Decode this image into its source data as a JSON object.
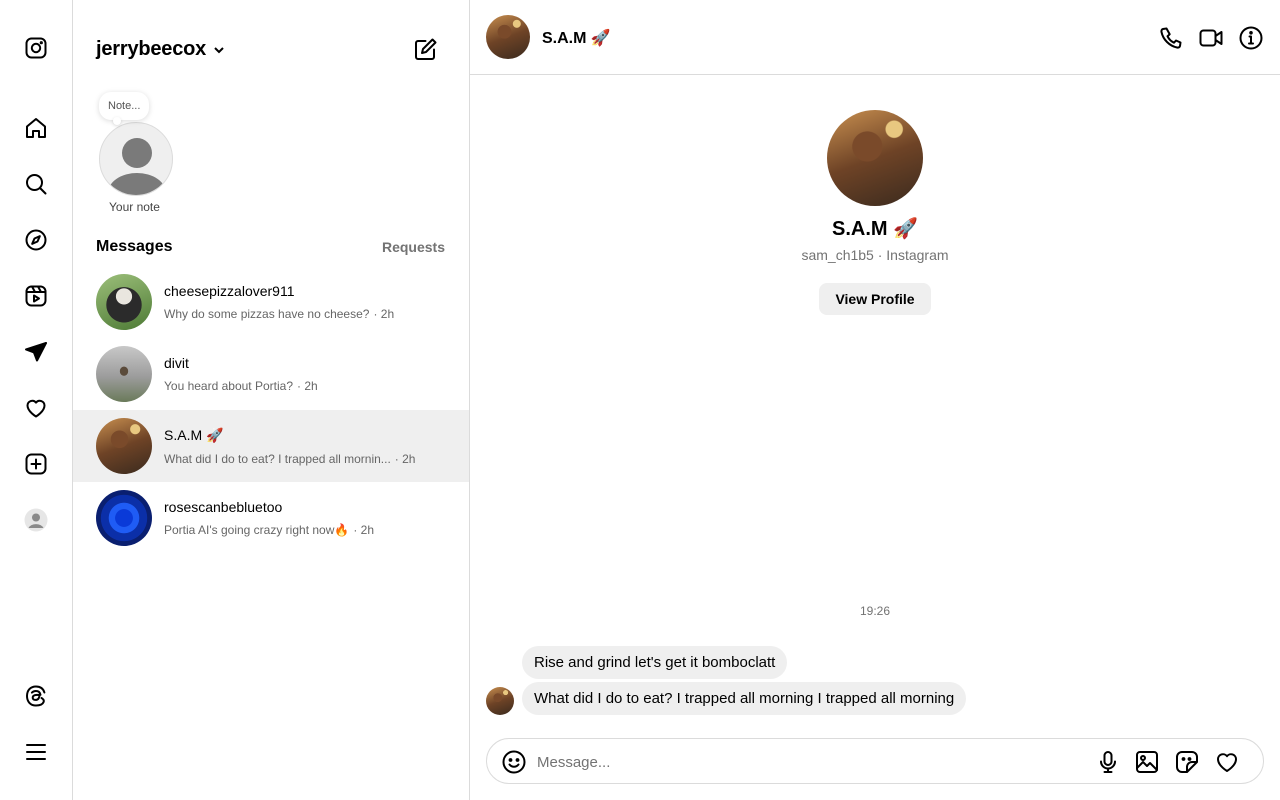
{
  "nav": {
    "items": [
      {
        "name": "instagram-logo-icon"
      },
      {
        "name": "home-icon"
      },
      {
        "name": "search-icon"
      },
      {
        "name": "explore-icon"
      },
      {
        "name": "reels-icon"
      },
      {
        "name": "messages-icon"
      },
      {
        "name": "notifications-heart-icon"
      },
      {
        "name": "create-plus-icon"
      },
      {
        "name": "profile-avatar-icon"
      },
      {
        "name": "threads-icon"
      },
      {
        "name": "more-menu-icon"
      }
    ]
  },
  "account": {
    "username": "jerrybeecox"
  },
  "note": {
    "bubble_text": "Note...",
    "label": "Your note"
  },
  "inbox": {
    "heading": "Messages",
    "requests_label": "Requests",
    "threads": [
      {
        "name": "cheesepizzalover911",
        "preview": "Why do some pizzas have no cheese?",
        "time": "· 2h",
        "avatar": "dog-photo"
      },
      {
        "name": "divit",
        "preview": "You heard about Portia?",
        "time": "· 2h",
        "avatar": "person-photo"
      },
      {
        "name": "S.A.M 🚀",
        "preview": "What did I do to eat? I trapped all mornin...",
        "time": "· 2h",
        "avatar": "sam-photo",
        "active": true
      },
      {
        "name": "rosescanbebluetoo",
        "preview": "Portia AI's going crazy right now🔥",
        "time": "· 2h",
        "avatar": "blue-rose-photo"
      }
    ]
  },
  "chat": {
    "header_name": "S.A.M 🚀",
    "profile": {
      "name": "S.A.M 🚀",
      "handle_line": "sam_ch1b5 · Instagram",
      "view_profile_label": "View Profile"
    },
    "timestamp": "19:26",
    "messages": [
      {
        "text": "Rise and grind let's get it bomboclatt"
      },
      {
        "text": "What did I do to eat? I trapped all morning I trapped all morning"
      }
    ],
    "composer": {
      "placeholder": "Message..."
    }
  },
  "colors": {
    "border": "#dbdbdb",
    "muted_text": "#737373",
    "active_row": "#efefef",
    "bubble": "#efefef"
  }
}
